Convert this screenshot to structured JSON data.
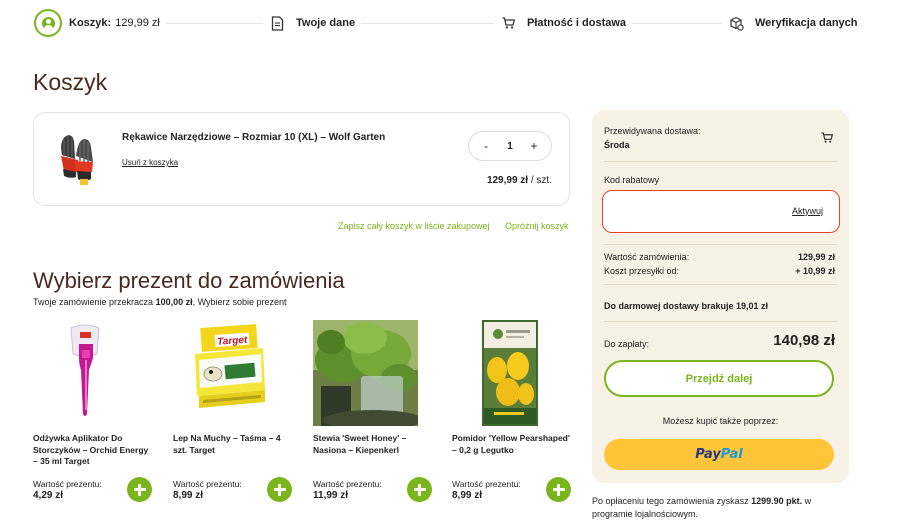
{
  "stepper": {
    "step1_label": "Koszyk:",
    "step1_value": "129,99 zł",
    "step2_label": "Twoje dane",
    "step3_label": "Płatność i dostawa",
    "step4_label": "Weryfikacja danych"
  },
  "page_title": "Koszyk",
  "cart": {
    "item_name": "Rękawice Narzędziowe – Rozmiar 10 (XL) – Wolf Garten",
    "remove_label": "Usuń z koszyka",
    "quantity": "1",
    "minus": "-",
    "plus": "+",
    "price": "129,99 zł",
    "price_unit": " / szt.",
    "save_list_label": "Zapisz cały koszyk w liście zakupowej",
    "empty_cart_label": "Opróżnij koszyk"
  },
  "gift": {
    "title": "Wybierz prezent do zamówienia",
    "subtitle_pre": "Twoje zamówienie przekracza ",
    "subtitle_amount": "100,00 zł",
    "subtitle_post": ", Wybierz sobie prezent",
    "value_label": "Wartość prezentu:",
    "items": [
      {
        "name": "Odżywka Aplikator Do Storczyków – Orchid Energy – 35 ml Target",
        "price": "4,29 zł"
      },
      {
        "name": "Lep Na Muchy – Taśma – 4 szt. Target",
        "price": "8,99 zł",
        "brand": "Target"
      },
      {
        "name": "Stewia 'Sweet Honey' – Nasiona – Kiepenkerl",
        "price": "11,99 zł"
      },
      {
        "name": "Pomidor 'Yellow Pearshaped' – 0,2 g Legutko",
        "price": "8,99 zł"
      }
    ]
  },
  "summary": {
    "delivery_label": "Przewidywana dostawa:",
    "delivery_day": "Środa",
    "coupon_label": "Kod rabatowy",
    "coupon_value": "",
    "coupon_button": "Aktywuj",
    "order_value_label": "Wartość zamówienia:",
    "order_value": "129,99 zł",
    "shipping_label": "Koszt przesyłki od:",
    "shipping_value": "+ 10,99 zł",
    "free_shipping_text": "Do darmowej dostawy brakuje 19,01 zł",
    "total_label": "Do zapłaty:",
    "total_value": "140,98 zł",
    "proceed_label": "Przejdź dalej",
    "alt_pay_label": "Możesz kupić także poprzez:",
    "paypal_a": "Pay",
    "paypal_b": "Pal"
  },
  "loyalty": {
    "pre": "Po opłaceniu tego zamówienia zyskasz ",
    "points": "1299.90 pkt.",
    "post": " w programie lojalnościowym."
  },
  "colors": {
    "accent_green": "#7ab51d",
    "title_brown": "#4a2a1f",
    "summary_bg": "#f8f2e6",
    "coupon_border": "#e0442f",
    "paypal_yellow": "#ffc439"
  }
}
